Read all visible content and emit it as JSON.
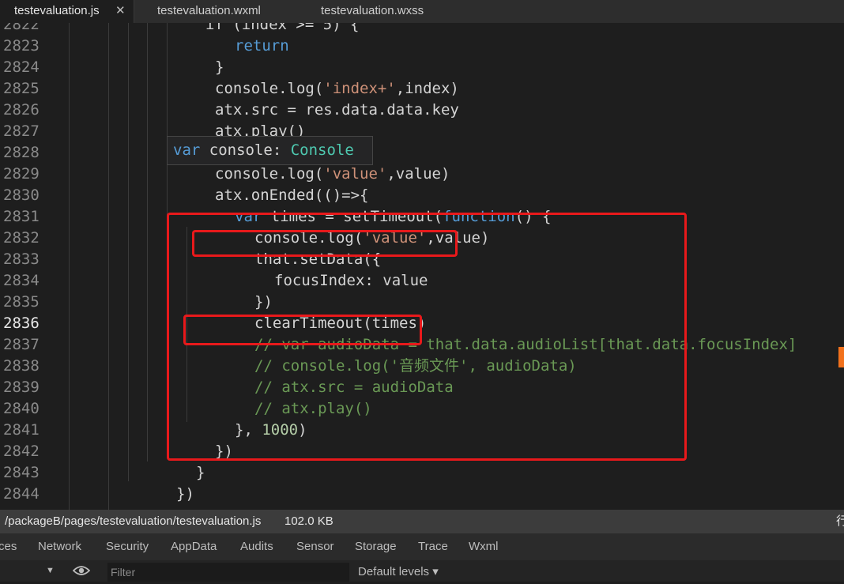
{
  "tabs": [
    {
      "label": "testevaluation.js",
      "active": true,
      "close_glyph": "✕"
    },
    {
      "label": "testevaluation.wxml",
      "active": false
    },
    {
      "label": "testevaluation.wxss",
      "active": false
    }
  ],
  "editor": {
    "current_line": "2836",
    "lines": [
      {
        "num": "2822",
        "tokens": [
          {
            "t": "if (index >= 5) {",
            "c": ""
          }
        ]
      },
      {
        "num": "2823",
        "tokens": [
          {
            "t": "return",
            "c": "kw"
          }
        ]
      },
      {
        "num": "2824",
        "tokens": [
          {
            "t": "}",
            "c": ""
          }
        ]
      },
      {
        "num": "2825",
        "tokens": [
          {
            "t": "console.log(",
            "c": ""
          },
          {
            "t": "'index+'",
            "c": "str"
          },
          {
            "t": ",index)",
            "c": ""
          }
        ]
      },
      {
        "num": "2826",
        "tokens": [
          {
            "t": "atx.src = res.data.data.key",
            "c": ""
          }
        ]
      },
      {
        "num": "2827",
        "tokens": [
          {
            "t": "atx.play()",
            "c": ""
          }
        ]
      },
      {
        "num": "2828",
        "tokens": []
      },
      {
        "num": "2829",
        "tokens": [
          {
            "t": "console.log(",
            "c": ""
          },
          {
            "t": "'value'",
            "c": "str"
          },
          {
            "t": ",value)",
            "c": ""
          }
        ]
      },
      {
        "num": "2830",
        "tokens": [
          {
            "t": "atx.onEnded(()=>{",
            "c": ""
          }
        ]
      },
      {
        "num": "2831",
        "tokens": [
          {
            "t": "var",
            "c": "kw"
          },
          {
            "t": " times = setTimeout(",
            "c": ""
          },
          {
            "t": "function",
            "c": "kw"
          },
          {
            "t": "() {",
            "c": ""
          }
        ]
      },
      {
        "num": "2832",
        "tokens": [
          {
            "t": "console.log(",
            "c": ""
          },
          {
            "t": "'value'",
            "c": "str"
          },
          {
            "t": ",value)",
            "c": ""
          }
        ]
      },
      {
        "num": "2833",
        "tokens": [
          {
            "t": "that.setData({",
            "c": ""
          }
        ]
      },
      {
        "num": "2834",
        "tokens": [
          {
            "t": "focusIndex: value",
            "c": ""
          }
        ]
      },
      {
        "num": "2835",
        "tokens": [
          {
            "t": "})",
            "c": ""
          }
        ]
      },
      {
        "num": "2836",
        "tokens": [
          {
            "t": "clearTimeout(times)",
            "c": ""
          }
        ]
      },
      {
        "num": "2837",
        "tokens": [
          {
            "t": "// var audioData = that.data.audioList[that.data.focusIndex]",
            "c": "cmt"
          }
        ]
      },
      {
        "num": "2838",
        "tokens": [
          {
            "t": "// console.log('音频文件', audioData)",
            "c": "cmt"
          }
        ]
      },
      {
        "num": "2839",
        "tokens": [
          {
            "t": "// atx.src = audioData",
            "c": "cmt"
          }
        ]
      },
      {
        "num": "2840",
        "tokens": [
          {
            "t": "// atx.play()",
            "c": "cmt"
          }
        ]
      },
      {
        "num": "2841",
        "tokens": [
          {
            "t": "}, ",
            "c": ""
          },
          {
            "t": "1000",
            "c": "num"
          },
          {
            "t": ")",
            "c": ""
          }
        ]
      },
      {
        "num": "2842",
        "tokens": [
          {
            "t": "})",
            "c": ""
          }
        ]
      },
      {
        "num": "2843",
        "tokens": [
          {
            "t": "}",
            "c": ""
          }
        ]
      },
      {
        "num": "2844",
        "tokens": [
          {
            "t": "})",
            "c": ""
          }
        ]
      }
    ]
  },
  "hover": {
    "keyword": "var",
    "name": " console: ",
    "type": "Console"
  },
  "status": {
    "path": "/packageB/pages/testevaluation/testevaluation.js",
    "size": "102.0 KB",
    "right_char": "行"
  },
  "devtools": {
    "tabs": [
      "ces",
      "Network",
      "Security",
      "AppData",
      "Audits",
      "Sensor",
      "Storage",
      "Trace",
      "Wxml"
    ],
    "filter_placeholder": "Filter",
    "levels": "Default levels ▾",
    "dropdown_glyph": "▼"
  },
  "colors": {
    "highlight_box": "#e8191b",
    "keyword": "#569cd6",
    "string": "#ce9178",
    "comment": "#6a9955",
    "type": "#4ec9b0",
    "number": "#b5cea8"
  }
}
